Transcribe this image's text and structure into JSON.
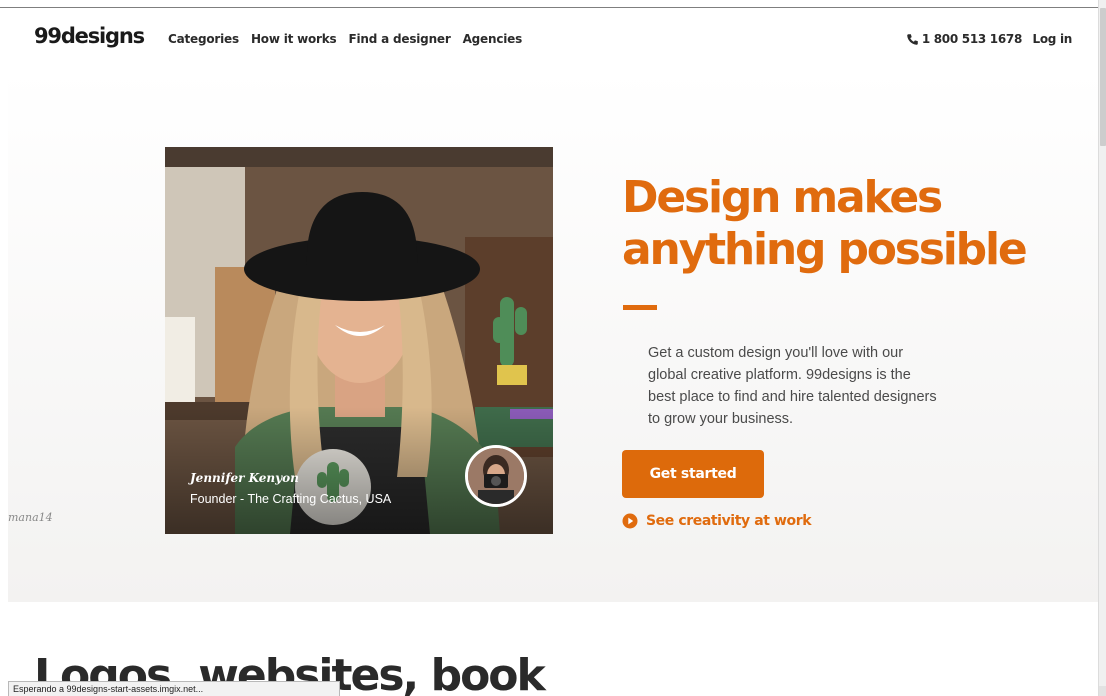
{
  "header": {
    "logo": "99designs",
    "nav": [
      "Categories",
      "How it works",
      "Find a designer",
      "Agencies"
    ],
    "phone": "1 800 513 1678",
    "login": "Log in"
  },
  "hero": {
    "headline": "Design makes anything possible",
    "description": "Get a custom design you'll love with our global creative platform. 99designs is the best place to find and hire talented designers to grow your business.",
    "cta": "Get started",
    "secondary_link": "See creativity at work",
    "photo_caption_name": "Jennifer Kenyon",
    "photo_caption_role": "Founder - The Crafting Cactus, USA",
    "side_credit": "mana14"
  },
  "lower": {
    "heading": "Logos, websites, book"
  },
  "status_bar": "Esperando a 99designs-start-assets.imgix.net...",
  "colors": {
    "accent": "#e06b0e",
    "button": "#dd6a0b"
  },
  "icons": {
    "phone": "phone-icon",
    "play": "play-circle-icon"
  }
}
